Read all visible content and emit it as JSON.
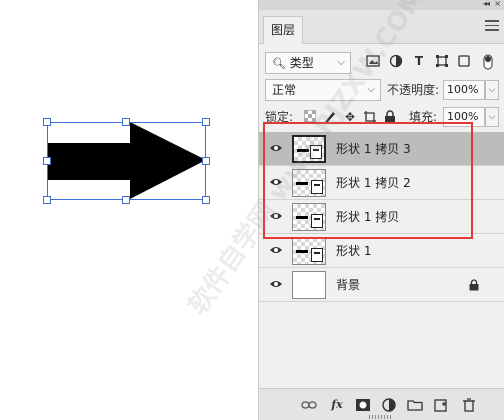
{
  "panel": {
    "tab_label": "图层",
    "collapse_glyph": "◂◂",
    "close_glyph": "×",
    "filter": {
      "kind_label": "类型"
    },
    "blend": {
      "mode_value": "正常",
      "opacity_label": "不透明度:",
      "opacity_value": "100%"
    },
    "lock": {
      "lock_label": "锁定:",
      "fill_label": "填充:",
      "fill_value": "100%"
    },
    "layers": [
      {
        "name": "形状 1 拷贝 3",
        "selected": true
      },
      {
        "name": "形状 1 拷贝 2",
        "selected": false
      },
      {
        "name": "形状 1 拷贝",
        "selected": false
      },
      {
        "name": "形状 1",
        "selected": false
      },
      {
        "name": "背景",
        "selected": false
      }
    ],
    "bottom_fx_label": "fx"
  },
  "watermark_text": "软件自学网 www.RJZXW.COM",
  "colors": {
    "highlight_border": "#e53935",
    "selection_handle": "#3b6fd6",
    "selected_row": "#bcbcbc"
  }
}
